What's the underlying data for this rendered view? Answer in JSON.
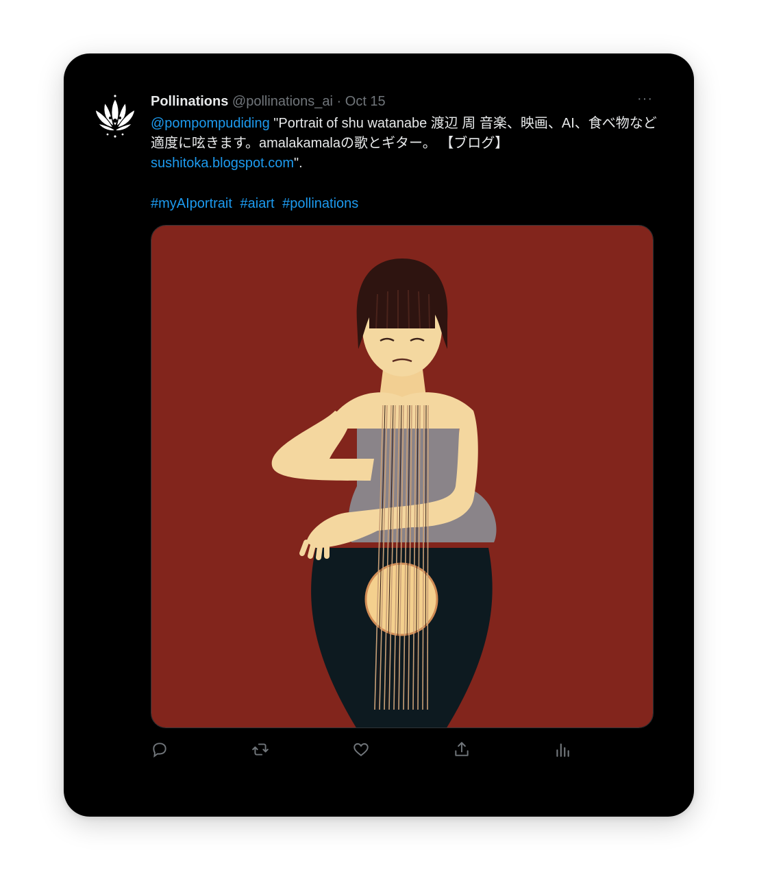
{
  "tweet": {
    "author_name": "Pollinations",
    "author_handle": "@pollinations_ai",
    "separator": "·",
    "date": "Oct 15",
    "more_label": "···",
    "mention": "@pompompudiding",
    "text_before_link": " \"Portrait of shu watanabe 渡辺 周 音楽、映画、AI、食べ物など適度に呟きます。amalakamalaの歌とギター。 【ブログ】",
    "link": "sushitoka.blogspot.com",
    "text_after_link": "\".",
    "hashtags": [
      "#myAIportrait",
      "#aiart",
      "#pollinations"
    ]
  },
  "media": {
    "background_color": "#82251c",
    "description_icon": "ai-portrait-image"
  },
  "actions": {
    "reply_icon": "reply-icon",
    "retweet_icon": "retweet-icon",
    "like_icon": "heart-icon",
    "share_icon": "share-icon",
    "analytics_icon": "analytics-icon"
  },
  "colors": {
    "accent": "#1d9bf0",
    "text": "#e7e9ea",
    "muted": "#71767b",
    "card": "#000000"
  }
}
